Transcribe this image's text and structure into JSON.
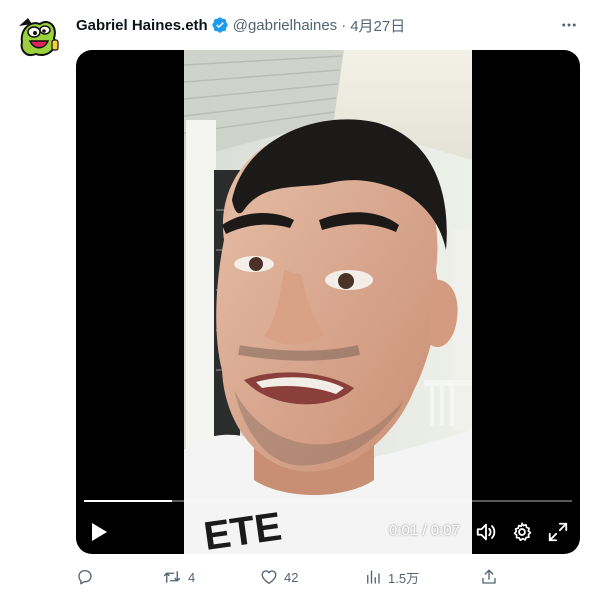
{
  "tweet": {
    "author": {
      "display_name": "Gabriel Haines.eth",
      "handle": "@gabrielhaines",
      "separator": "·",
      "date": "4月27日",
      "verified": true,
      "avatar_icon": "cartoon-pickle-avatar"
    },
    "video": {
      "current_time": "0:01",
      "time_separator": " / ",
      "duration": "0:07",
      "progress_fraction": 0.18,
      "play_icon": "play-icon",
      "volume_icon": "volume-icon",
      "settings_icon": "gear-icon",
      "fullscreen_icon": "expand-icon"
    },
    "actions": {
      "reply_count": "",
      "retweet_count": "4",
      "like_count": "42",
      "view_count": "1.5万",
      "share_icon": "share-icon"
    }
  },
  "colors": {
    "text_primary": "#0f1419",
    "text_secondary": "#536471",
    "verified_blue": "#1d9bf0",
    "media_background": "#000000"
  }
}
